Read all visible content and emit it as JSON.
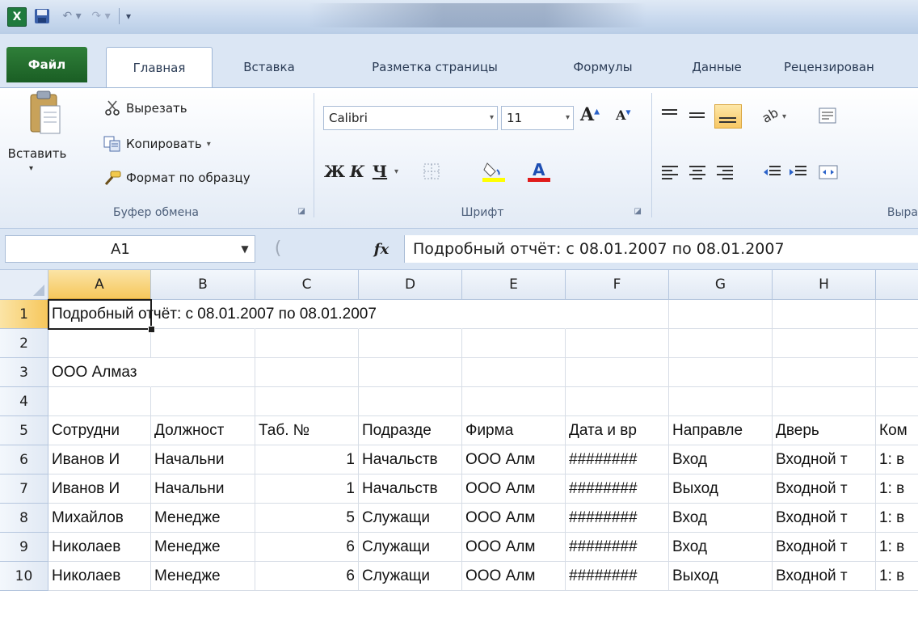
{
  "quick_access": {
    "app_icon_letter": "X",
    "undo_symbol": "↶ ▾",
    "redo_symbol": "↷ ▾",
    "customize_symbol": "▾"
  },
  "tabs": [
    {
      "id": "file",
      "label": "Файл"
    },
    {
      "id": "home",
      "label": "Главная"
    },
    {
      "id": "insert",
      "label": "Вставка"
    },
    {
      "id": "layout",
      "label": "Разметка страницы"
    },
    {
      "id": "formulas",
      "label": "Формулы"
    },
    {
      "id": "data",
      "label": "Данные"
    },
    {
      "id": "review",
      "label": "Рецензирован"
    }
  ],
  "clipboard": {
    "paste_label": "Вставить",
    "cut_label": "Вырезать",
    "copy_label": "Копировать",
    "format_painter_label": "Формат по образцу",
    "group_label": "Буфер обмена"
  },
  "font": {
    "name": "Calibri",
    "size": "11",
    "bold_label": "Ж",
    "italic_label": "К",
    "underline_label": "Ч",
    "group_label": "Шрифт"
  },
  "alignment": {
    "group_label": "Выра"
  },
  "formula_bar": {
    "name_box": "A1",
    "fx_label": "fx",
    "formula": "Подробный отчёт: с 08.01.2007 по 08.01.2007"
  },
  "columns": [
    "A",
    "B",
    "C",
    "D",
    "E",
    "F",
    "G",
    "H",
    ""
  ],
  "rows": [
    {
      "num": "1",
      "cells": [
        "Подробный отчёт: с 08.01.2007 по 08.01.2007",
        "",
        "",
        "",
        "",
        "",
        "",
        "",
        ""
      ]
    },
    {
      "num": "2",
      "cells": [
        "",
        "",
        "",
        "",
        "",
        "",
        "",
        "",
        ""
      ]
    },
    {
      "num": "3",
      "cells": [
        "ООО Алмаз",
        "",
        "",
        "",
        "",
        "",
        "",
        "",
        ""
      ]
    },
    {
      "num": "4",
      "cells": [
        "",
        "",
        "",
        "",
        "",
        "",
        "",
        "",
        ""
      ]
    },
    {
      "num": "5",
      "cells": [
        "Сотрудни",
        "Должност",
        "Таб. №",
        "Подразде",
        "Фирма",
        "Дата и вр",
        "Направле",
        "Дверь",
        "Ком"
      ]
    },
    {
      "num": "6",
      "cells": [
        "Иванов И",
        "Начальни",
        "1",
        "Начальств",
        "ООО Алм",
        "########",
        "Вход",
        "Входной т",
        "1: в"
      ]
    },
    {
      "num": "7",
      "cells": [
        "Иванов И",
        "Начальни",
        "1",
        "Начальств",
        "ООО Алм",
        "########",
        "Выход",
        "Входной т",
        "1: в"
      ]
    },
    {
      "num": "8",
      "cells": [
        "Михайлов",
        "Менедже",
        "5",
        "Служащи",
        "ООО Алм",
        "########",
        "Вход",
        "Входной т",
        "1: в"
      ]
    },
    {
      "num": "9",
      "cells": [
        "Николаев",
        "Менедже",
        "6",
        "Служащи",
        "ООО Алм",
        "########",
        "Вход",
        "Входной т",
        "1: в"
      ]
    },
    {
      "num": "10",
      "cells": [
        "Николаев",
        "Менедже",
        "6",
        "Служащи",
        "ООО Алм",
        "########",
        "Выход",
        "Входной т",
        "1: в"
      ]
    }
  ],
  "selected_cell": "A1"
}
